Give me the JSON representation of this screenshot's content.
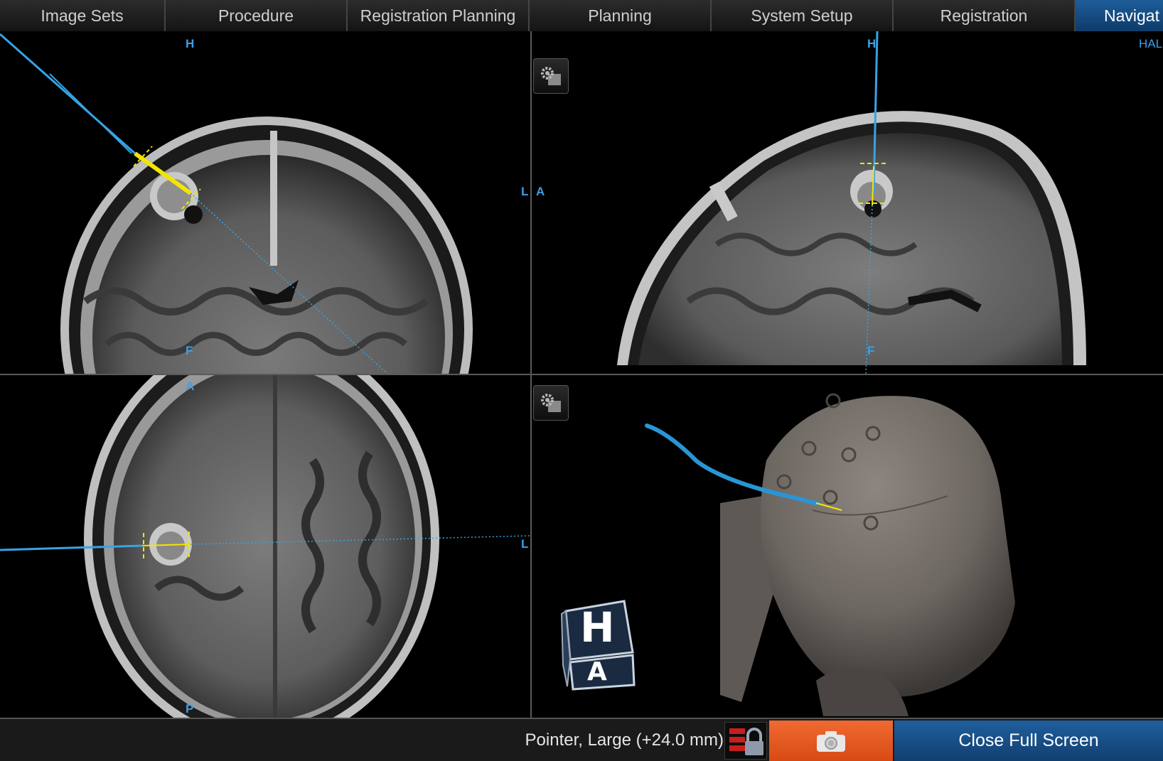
{
  "tabs": [
    {
      "label": "Image Sets",
      "width": 233
    },
    {
      "label": "Procedure",
      "width": 256
    },
    {
      "label": "Registration Planning",
      "width": 256
    },
    {
      "label": "Planning",
      "width": 256
    },
    {
      "label": "System Setup",
      "width": 256
    },
    {
      "label": "Registration",
      "width": 256
    },
    {
      "label": "Navigat",
      "active": true
    }
  ],
  "views": {
    "coronal": {
      "top": "H",
      "bottom": "F",
      "right": "L"
    },
    "sagittal": {
      "top": "H",
      "left": "A",
      "bottom": "F",
      "corner": "HAL"
    },
    "axial": {
      "top": "A",
      "bottom": "P",
      "right": "L"
    },
    "three_d": {
      "cube_top": "H",
      "cube_front": "A"
    }
  },
  "status": {
    "tool_label": "Pointer, Large (+24.0 mm)"
  },
  "buttons": {
    "close_full_screen": "Close Full Screen"
  },
  "colors": {
    "accent_blue": "#3ea0e8",
    "trajectory_yellow": "#f2e600",
    "camera_orange": "#e8581f",
    "tab_active": "#1a5590"
  },
  "icons": [
    "gear-icon",
    "lock-icon",
    "camera-icon",
    "orientation-cube-icon"
  ]
}
